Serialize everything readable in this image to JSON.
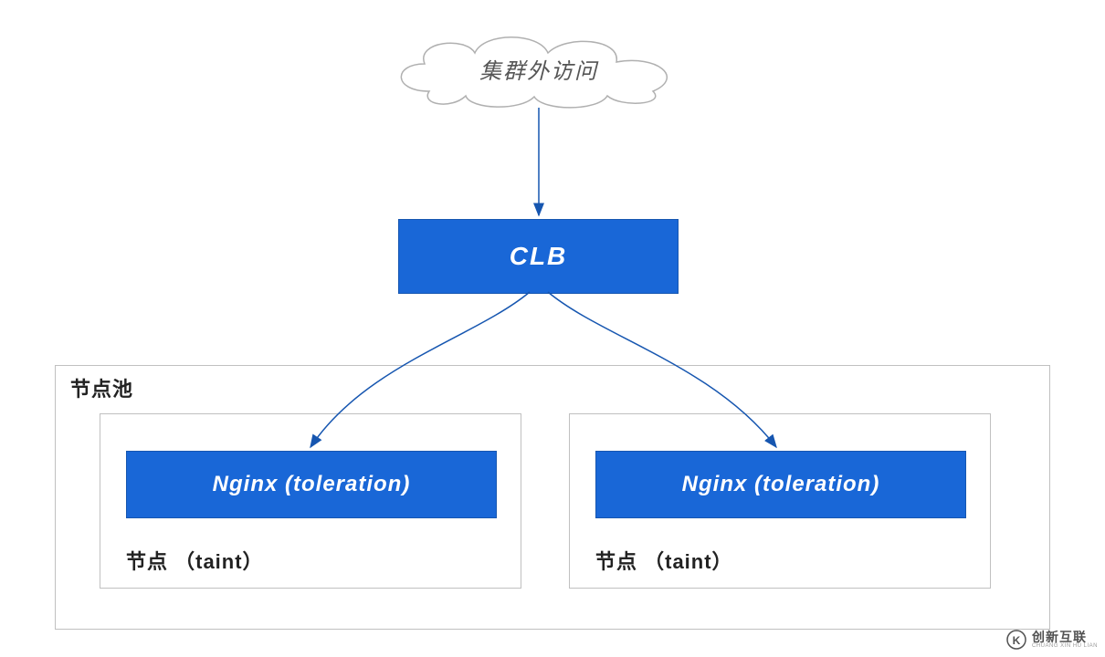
{
  "diagram": {
    "cloud_label": "集群外访问",
    "clb_label": "CLB",
    "node_pool_label": "节点池",
    "nginx_label": "Nginx (toleration)",
    "node_caption": "节点 （taint）"
  },
  "colors": {
    "primary": "#1967d7",
    "border_gray": "#c0c0c0",
    "arrow": "#1656b0"
  },
  "watermark": {
    "logo_letter": "K",
    "main": "创新互联",
    "sub": "CHUANG XIN HU LIAN"
  }
}
